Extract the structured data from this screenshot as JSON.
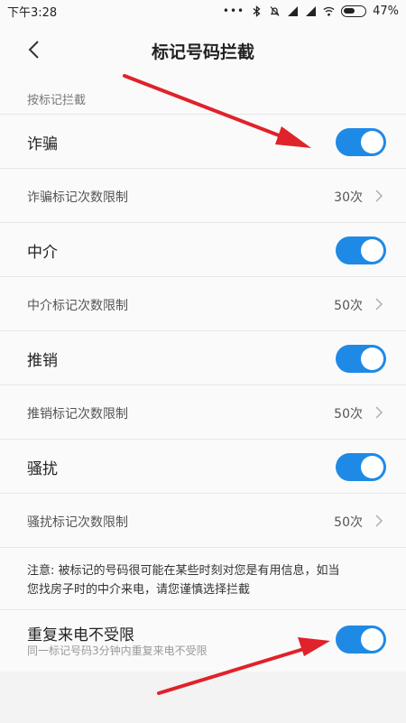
{
  "status_bar": {
    "time": "下午3:28",
    "dots": "•••",
    "battery": "47%"
  },
  "header": {
    "title": "标记号码拦截"
  },
  "section": {
    "label": "按标记拦截"
  },
  "categories": [
    {
      "title": "诈骗",
      "enabled": true,
      "limit_label": "诈骗标记次数限制",
      "limit_value": "30次"
    },
    {
      "title": "中介",
      "enabled": true,
      "limit_label": "中介标记次数限制",
      "limit_value": "50次"
    },
    {
      "title": "推销",
      "enabled": true,
      "limit_label": "推销标记次数限制",
      "limit_value": "50次"
    },
    {
      "title": "骚扰",
      "enabled": true,
      "limit_label": "骚扰标记次数限制",
      "limit_value": "50次"
    }
  ],
  "note": {
    "line1": "注意: 被标记的号码很可能在某些时刻对您是有用信息，如当",
    "line2": "您找房子时的中介来电，请您谨慎选择拦截"
  },
  "repeat_call": {
    "title": "重复来电不受限",
    "description": "同一标记号码3分钟内重复来电不受限",
    "enabled": true
  },
  "colors": {
    "accent": "#1e8ae6",
    "arrow": "#e0222a"
  }
}
